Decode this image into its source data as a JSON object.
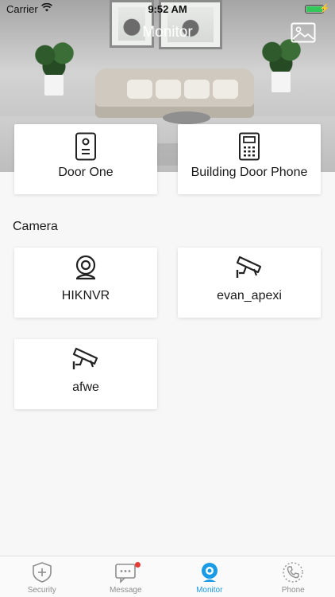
{
  "status_bar": {
    "carrier": "Carrier",
    "time": "9:52 AM"
  },
  "header": {
    "title": "Monitor",
    "gallery_icon": "image-icon"
  },
  "door_stations": [
    {
      "label": "Door One",
      "icon": "door-station-icon"
    },
    {
      "label": "Building Door Phone",
      "icon": "building-door-phone-icon"
    }
  ],
  "camera_section": {
    "title": "Camera",
    "items": [
      {
        "label": "HIKNVR",
        "icon": "nvr-icon"
      },
      {
        "label": "evan_apexi",
        "icon": "cctv-camera-icon"
      },
      {
        "label": "afwe",
        "icon": "cctv-camera-icon"
      }
    ]
  },
  "tabs": [
    {
      "label": "Security",
      "icon": "shield-plus-icon",
      "active": false
    },
    {
      "label": "Message",
      "icon": "message-icon",
      "active": false,
      "badge": true
    },
    {
      "label": "Monitor",
      "icon": "webcam-icon",
      "active": true
    },
    {
      "label": "Phone",
      "icon": "phone-icon",
      "active": false
    }
  ],
  "colors": {
    "accent": "#1a9be6",
    "badge": "#e53935",
    "battery": "#34c759"
  }
}
